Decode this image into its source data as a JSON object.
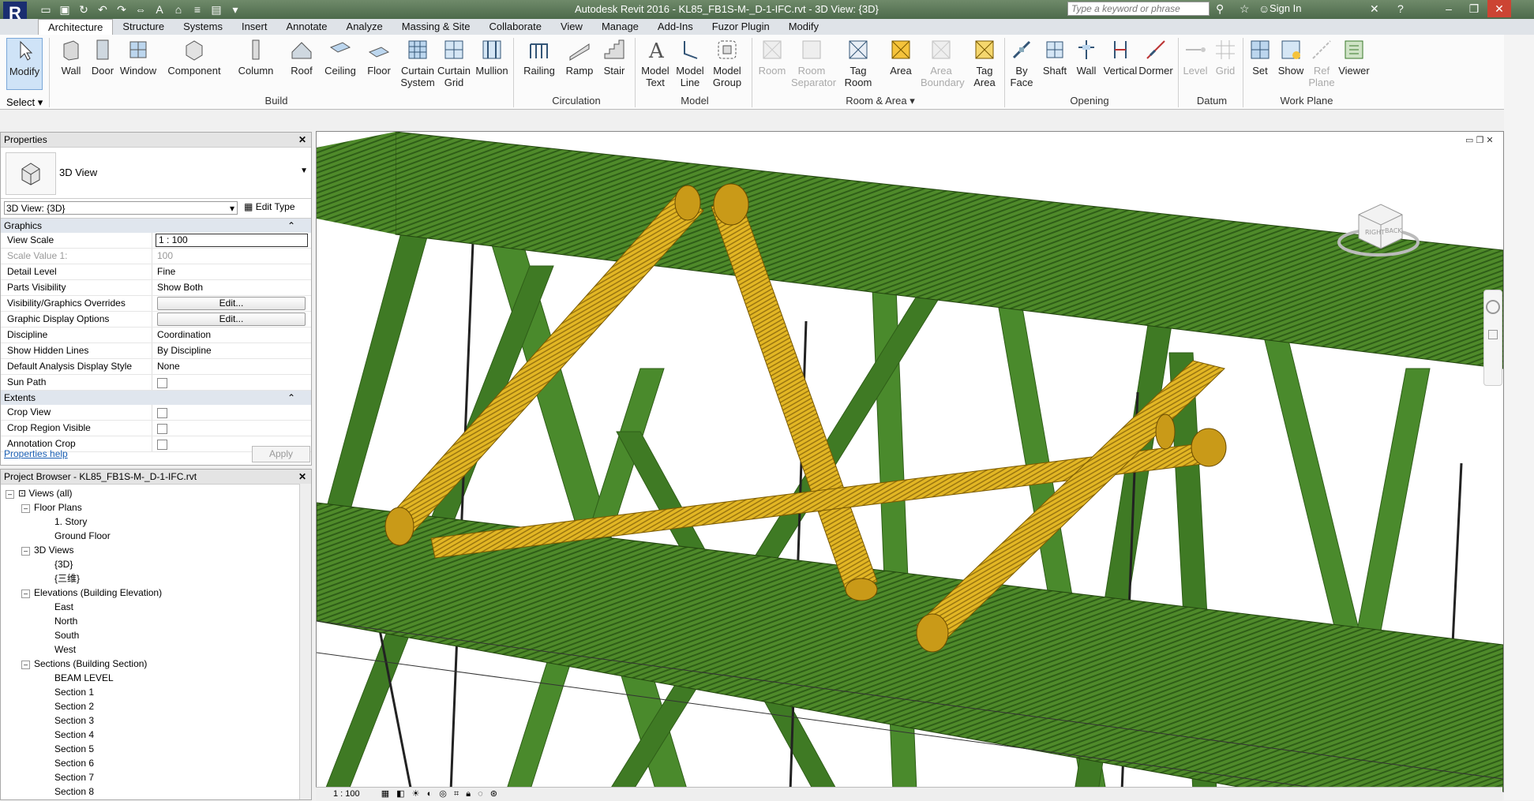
{
  "app": {
    "title": "Autodesk Revit 2016 -    KL85_FB1S-M-_D-1-IFC.rvt - 3D View: {3D}",
    "search_placeholder": "Type a keyword or phrase",
    "sign_in": "Sign In"
  },
  "tabs": [
    "Architecture",
    "Structure",
    "Systems",
    "Insert",
    "Annotate",
    "Analyze",
    "Massing & Site",
    "Collaborate",
    "View",
    "Manage",
    "Add-Ins",
    "Fuzor Plugin",
    "Modify"
  ],
  "ribbon": {
    "select": "Select",
    "buttons": {
      "modify": "Modify",
      "wall": "Wall",
      "door": "Door",
      "window": "Window",
      "component": "Component",
      "column": "Column",
      "roof": "Roof",
      "ceiling": "Ceiling",
      "floor": "Floor",
      "curtain_system": "Curtain System",
      "curtain_grid": "Curtain Grid",
      "mullion": "Mullion",
      "railing": "Railing",
      "ramp": "Ramp",
      "stair": "Stair",
      "model_text": "Model Text",
      "model_line": "Model Line",
      "model_group": "Model Group",
      "room": "Room",
      "room_separator": "Room Separator",
      "tag_room": "Tag Room",
      "area": "Area",
      "area_boundary": "Area Boundary",
      "tag_area": "Tag Area",
      "by_face": "By Face",
      "shaft": "Shaft",
      "wall2": "Wall",
      "vertical": "Vertical",
      "dormer": "Dormer",
      "level": "Level",
      "grid": "Grid",
      "set": "Set",
      "show": "Show",
      "ref_plane": "Ref Plane",
      "viewer": "Viewer"
    },
    "panels": {
      "build": "Build",
      "circulation": "Circulation",
      "model": "Model",
      "room_area": "Room & Area",
      "opening": "Opening",
      "datum": "Datum",
      "work_plane": "Work Plane"
    }
  },
  "properties": {
    "header": "Properties",
    "type_name": "3D View",
    "selector": "3D View: {3D}",
    "edit_type": "Edit Type",
    "section_graphics": "Graphics",
    "section_extents": "Extents",
    "rows": [
      {
        "k": "View Scale",
        "v": "1 : 100"
      },
      {
        "k": "Scale Value    1:",
        "v": "100"
      },
      {
        "k": "Detail Level",
        "v": "Fine"
      },
      {
        "k": "Parts Visibility",
        "v": "Show Both"
      },
      {
        "k": "Visibility/Graphics Overrides",
        "v": "Edit..."
      },
      {
        "k": "Graphic Display Options",
        "v": "Edit..."
      },
      {
        "k": "Discipline",
        "v": "Coordination"
      },
      {
        "k": "Show Hidden Lines",
        "v": "By Discipline"
      },
      {
        "k": "Default Analysis Display Style",
        "v": "None"
      },
      {
        "k": "Sun Path",
        "v": ""
      }
    ],
    "extents_rows": [
      {
        "k": "Crop View"
      },
      {
        "k": "Crop Region Visible"
      },
      {
        "k": "Annotation Crop"
      }
    ],
    "help": "Properties help",
    "apply": "Apply"
  },
  "browser": {
    "header": "Project Browser - KL85_FB1S-M-_D-1-IFC.rvt",
    "root": "Views (all)",
    "floor_plans": "Floor Plans",
    "floor_items": [
      "1. Story",
      "Ground Floor"
    ],
    "views3d": "3D Views",
    "views3d_items": [
      "{3D}",
      "{三维}"
    ],
    "elevations": "Elevations (Building Elevation)",
    "elevation_items": [
      "East",
      "North",
      "South",
      "West"
    ],
    "sections": "Sections (Building Section)",
    "section_items": [
      "BEAM LEVEL",
      "Section 1",
      "Section 2",
      "Section 3",
      "Section 4",
      "Section 5",
      "Section 6",
      "Section 7",
      "Section 8"
    ]
  },
  "viewcube": {
    "right": "RIGHT",
    "back": "BACK"
  },
  "status": {
    "scale": "1 : 100"
  }
}
